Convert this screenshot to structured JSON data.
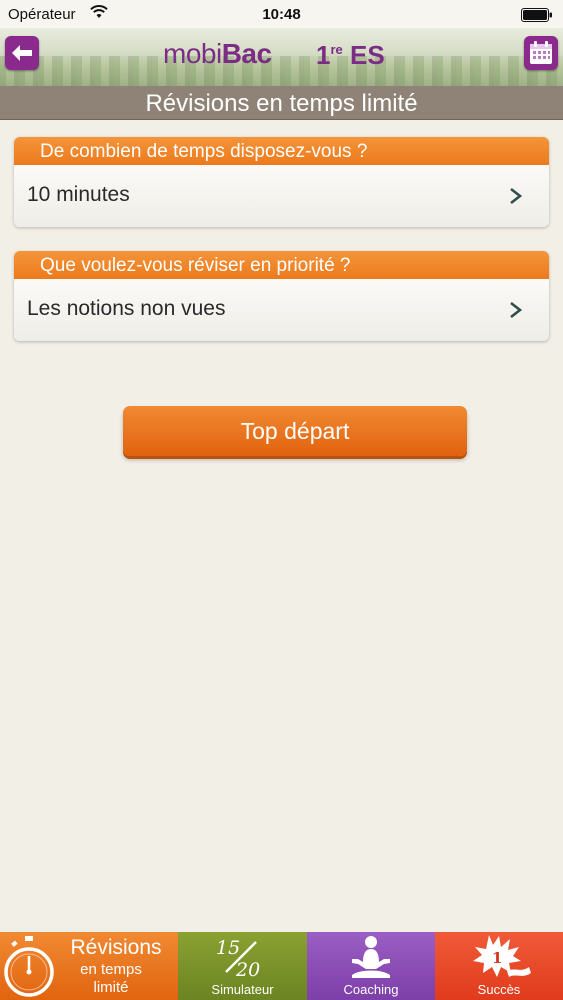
{
  "status_bar": {
    "carrier": "Opérateur",
    "time": "10:48"
  },
  "header": {
    "logo_light": "mobi",
    "logo_bold": "Bac",
    "grade_number": "1",
    "grade_suffix": "re",
    "grade_track": "ES",
    "back_icon": "back-arrow-icon",
    "calendar_icon": "calendar-icon",
    "brand_color": "#7b2d86"
  },
  "page_title": "Révisions en temps limité",
  "questions": [
    {
      "label": "De combien de temps disposez-vous ?",
      "value": "10 minutes"
    },
    {
      "label": "Que voulez-vous réviser en priorité ?",
      "value": "Les notions non vues"
    }
  ],
  "start_button": {
    "label": "Top départ"
  },
  "tabs": {
    "revisions": {
      "line1": "Révisions",
      "line2": "en temps",
      "line3": "limité",
      "icon": "stopwatch-icon",
      "color": "#ec7a1c"
    },
    "simulateur": {
      "label": "Simulateur",
      "score_top": "15",
      "score_bottom": "20",
      "icon": "score-icon",
      "color": "#7a9229"
    },
    "coaching": {
      "label": "Coaching",
      "icon": "meditation-icon",
      "color": "#8a4cb6"
    },
    "succes": {
      "label": "Succès",
      "badge": "1",
      "icon": "burst-icon",
      "color": "#e8482a"
    }
  },
  "colors": {
    "accent_orange": "#ec7a1c",
    "title_bar": "#8e8376",
    "background": "#f2efe7"
  }
}
